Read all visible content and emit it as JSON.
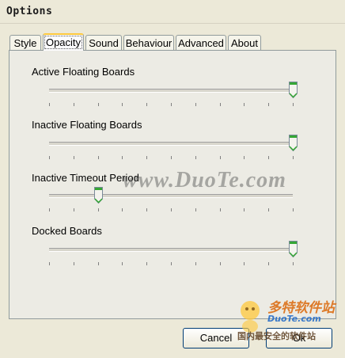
{
  "window": {
    "title": "Options"
  },
  "tabs": [
    {
      "label": "Style",
      "active": false
    },
    {
      "label": "Opacity",
      "active": true
    },
    {
      "label": "Sound",
      "active": false
    },
    {
      "label": "Behaviour",
      "active": false
    },
    {
      "label": "Advanced",
      "active": false
    },
    {
      "label": "About",
      "active": false
    }
  ],
  "sliders": [
    {
      "label": "Active Floating Boards",
      "value_fraction": 1.0
    },
    {
      "label": "Inactive Floating Boards",
      "value_fraction": 1.0
    },
    {
      "label": "Inactive Timeout Period",
      "value_fraction": 0.2
    },
    {
      "label": "Docked Boards",
      "value_fraction": 1.0
    }
  ],
  "buttons": {
    "cancel": "Cancel",
    "ok": "Ok"
  },
  "watermarks": {
    "center": "www.DuoTe.com",
    "logo_text": "多特软件站",
    "logo_url": "DuoTe.com",
    "logo_caption": "国内最安全的软件站"
  },
  "colors": {
    "tab_highlight": "#ffc83c",
    "thumb_green": "#35a735"
  }
}
